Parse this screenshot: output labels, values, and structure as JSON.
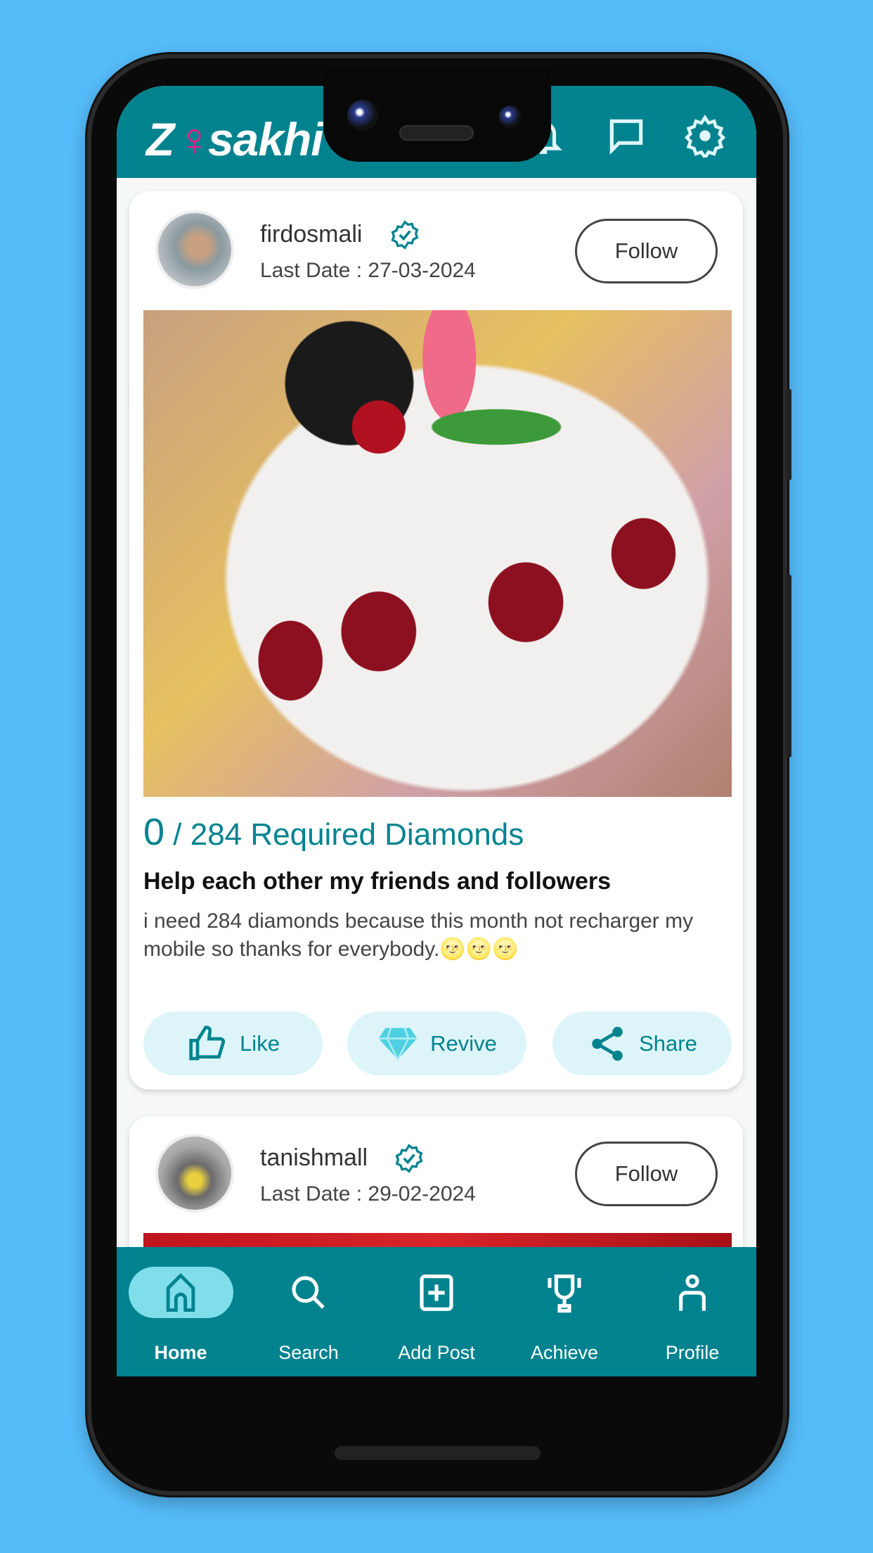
{
  "app": {
    "logo_text": "Zisakhi",
    "brand_color": "#00838f",
    "accent_pink": "#e91e8c"
  },
  "header": {
    "icons": [
      "bell-icon",
      "chat-icon",
      "gear-icon"
    ]
  },
  "posts": [
    {
      "username": "firdosmali",
      "date": "Last Date : 27-03-2024",
      "follow_label": "Follow",
      "received": "0",
      "required": "/ 284 Required Diamonds",
      "title": "Help each other my friends and followers",
      "description": "i need 284 diamonds because this month not recharger my mobile so thanks for everybody.🌝🌝🌝",
      "actions": [
        {
          "label": "Like",
          "icon": "thumbs-up-icon"
        },
        {
          "label": "Revive",
          "icon": "diamond-icon"
        },
        {
          "label": "Share",
          "icon": "share-icon"
        }
      ]
    },
    {
      "username": "tanishmall",
      "date": "Last Date : 29-02-2024",
      "follow_label": "Follow"
    }
  ],
  "nav": {
    "items": [
      {
        "label": "Home",
        "icon": "home-icon",
        "active": true
      },
      {
        "label": "Search",
        "icon": "search-icon"
      },
      {
        "label": "Add Post",
        "icon": "add-post-icon"
      },
      {
        "label": "Achieve",
        "icon": "trophy-icon"
      },
      {
        "label": "Profile",
        "icon": "profile-icon"
      }
    ]
  }
}
